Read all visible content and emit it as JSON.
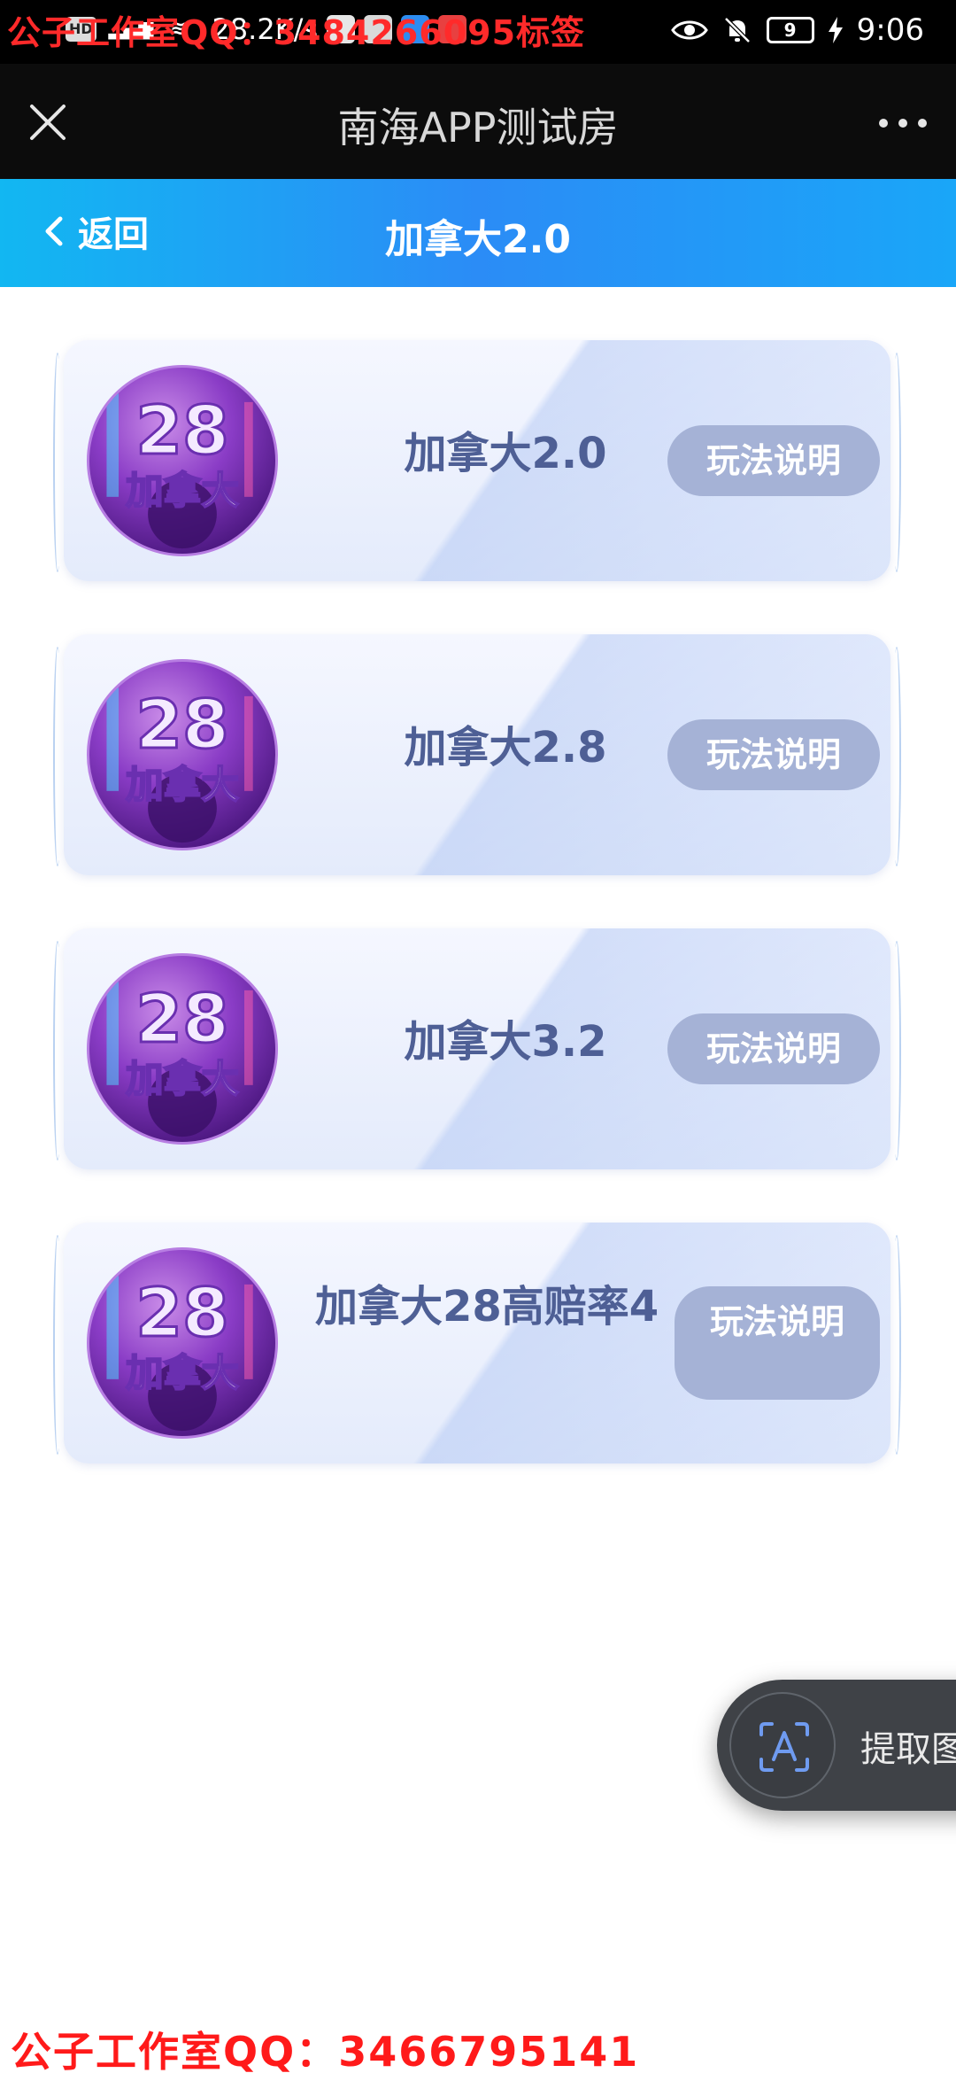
{
  "watermark": {
    "top": "公子工作室QQ：3484266095标签",
    "bottom": "公子工作室QQ：3466795141"
  },
  "status_bar": {
    "network_speed": "28.2K/s",
    "battery_level": "9",
    "time": "9:06"
  },
  "title_bar": {
    "title": "南海APP测试房"
  },
  "header": {
    "back_label": "返回",
    "title": "加拿大2.0"
  },
  "rooms": [
    {
      "name": "加拿大2.0",
      "button_label": "玩法说明",
      "avatar_text_top": "28",
      "avatar_text_bottom": "加拿大"
    },
    {
      "name": "加拿大2.8",
      "button_label": "玩法说明",
      "avatar_text_top": "28",
      "avatar_text_bottom": "加拿大"
    },
    {
      "name": "加拿大3.2",
      "button_label": "玩法说明",
      "avatar_text_top": "28",
      "avatar_text_bottom": "加拿大"
    },
    {
      "name": "加拿大28高赔率4",
      "button_label": "玩法说明",
      "avatar_text_top": "28",
      "avatar_text_bottom": "加拿大"
    }
  ],
  "float_tool": {
    "label": "提取图"
  },
  "colors": {
    "header_gradient_start": "#12b7f2",
    "header_gradient_end": "#2b8cf6",
    "card_text": "#4e5f95",
    "button_bg": "#a5b2d6",
    "watermark": "#ff2a2a"
  }
}
